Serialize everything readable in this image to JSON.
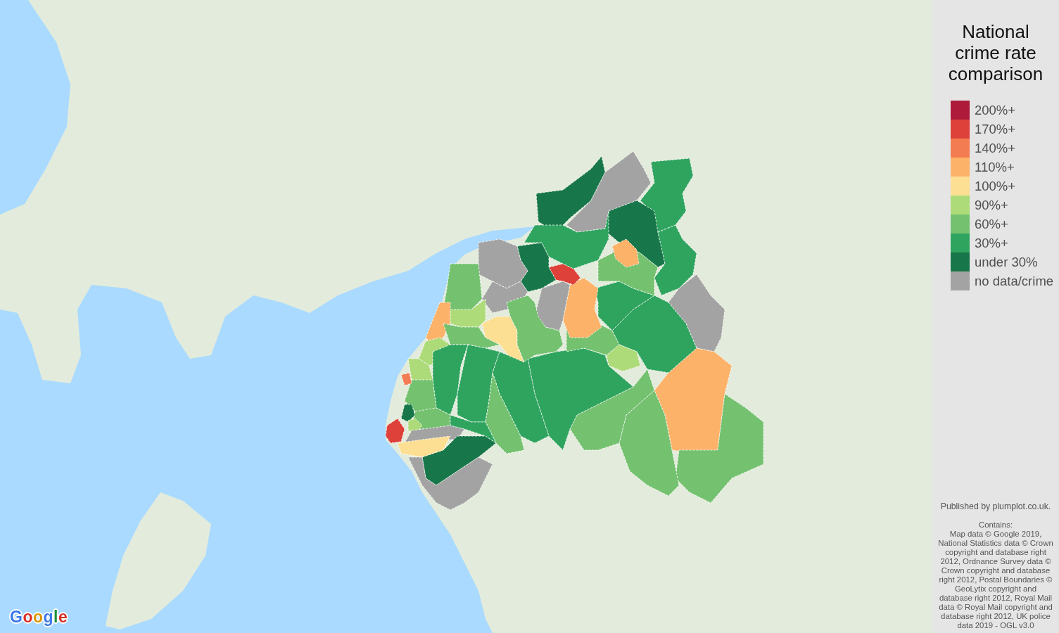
{
  "map": {
    "logo": "Google",
    "regions": [
      {
        "color": "#18774a"
      },
      {
        "color": "#a3a3a3"
      },
      {
        "color": "#2fa45f"
      },
      {
        "color": "#18774a"
      },
      {
        "color": "#2fa45f"
      },
      {
        "color": "#a3a3a3"
      },
      {
        "color": "#fdb26a"
      },
      {
        "color": "#74c170"
      },
      {
        "color": "#74c170"
      },
      {
        "color": "#74c170"
      },
      {
        "color": "#2fa45f"
      },
      {
        "color": "#aedb79"
      },
      {
        "color": "#2fa45f"
      },
      {
        "color": "#74c170"
      },
      {
        "color": "#2fa45f"
      },
      {
        "color": "#74c170"
      },
      {
        "color": "#fdb26a"
      },
      {
        "color": "#fdb26a"
      },
      {
        "color": "#de4139"
      },
      {
        "color": "#a3a3a3"
      },
      {
        "color": "#18774a"
      },
      {
        "color": "#2fa45f"
      },
      {
        "color": "#a3a3a3"
      },
      {
        "color": "#a3a3a3"
      },
      {
        "color": "#74c170"
      },
      {
        "color": "#fdb26a"
      },
      {
        "color": "#aedb79"
      },
      {
        "color": "#fddf93"
      },
      {
        "color": "#74c170"
      },
      {
        "color": "#74c170"
      },
      {
        "color": "#aedb79"
      },
      {
        "color": "#2fa45f"
      },
      {
        "color": "#2fa45f"
      },
      {
        "color": "#2fa45f"
      },
      {
        "color": "#74c170"
      },
      {
        "color": "#aedb79"
      },
      {
        "color": "#74c170"
      },
      {
        "color": "#f47c52"
      },
      {
        "color": "#18774a"
      },
      {
        "color": "#de4139"
      },
      {
        "color": "#74c170"
      },
      {
        "color": "#aedb79"
      },
      {
        "color": "#a3a3a3"
      },
      {
        "color": "#fddf93"
      },
      {
        "color": "#18774a"
      },
      {
        "color": "#a3a3a3"
      },
      {
        "color": "#2fa45f"
      }
    ]
  },
  "legend": {
    "title": "National crime rate comparison",
    "items": [
      {
        "label": "200%+",
        "color": "#ad1a3a"
      },
      {
        "label": "170%+",
        "color": "#de4139"
      },
      {
        "label": "140%+",
        "color": "#f47c52"
      },
      {
        "label": "110%+",
        "color": "#fdb26a"
      },
      {
        "label": "100%+",
        "color": "#fddf93"
      },
      {
        "label": "90%+",
        "color": "#aedb79"
      },
      {
        "label": "60%+",
        "color": "#74c170"
      },
      {
        "label": "30%+",
        "color": "#2fa45f"
      },
      {
        "label": "under 30%",
        "color": "#18774a"
      },
      {
        "label": "no data/crime",
        "color": "#a3a3a3"
      }
    ]
  },
  "publisher": "Published by plumplot.co.uk.",
  "attribution": {
    "heading": "Contains:",
    "text": "Map data © Google 2019, National Statistics data © Crown copyright and database right 2012, Ordnance Survey data © Crown copyright and database right 2012, Postal Boundaries © GeoLytix copyright and database right 2012, Royal Mail data © Royal Mail copyright and database right 2012, UK police data 2019 - OGL v3.0"
  }
}
